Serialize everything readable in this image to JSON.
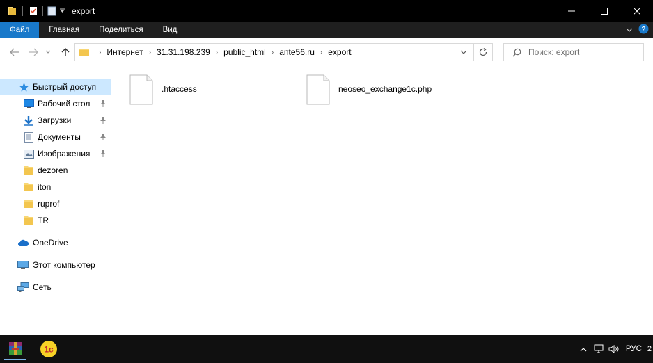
{
  "window": {
    "title": "export"
  },
  "ribbon": {
    "tabs": [
      "Файл",
      "Главная",
      "Поделиться",
      "Вид"
    ]
  },
  "address": {
    "breadcrumbs": [
      "Интернет",
      "31.31.198.239",
      "public_html",
      "ante56.ru",
      "export"
    ]
  },
  "search": {
    "placeholder": "Поиск: export"
  },
  "sidebar": {
    "quick_access": "Быстрый доступ",
    "items": [
      {
        "label": "Рабочий стол",
        "icon": "desktop-icon",
        "pinned": true
      },
      {
        "label": "Загрузки",
        "icon": "download-icon",
        "pinned": true
      },
      {
        "label": "Документы",
        "icon": "documents-icon",
        "pinned": true
      },
      {
        "label": "Изображения",
        "icon": "pictures-icon",
        "pinned": true
      },
      {
        "label": "dezoren",
        "icon": "folder-icon",
        "pinned": false
      },
      {
        "label": "iton",
        "icon": "folder-icon",
        "pinned": false
      },
      {
        "label": "ruprof",
        "icon": "folder-icon",
        "pinned": false
      },
      {
        "label": "TR",
        "icon": "folder-icon",
        "pinned": false
      }
    ],
    "onedrive": "OneDrive",
    "this_pc": "Этот компьютер",
    "network": "Сеть"
  },
  "files": [
    {
      "name": ".htaccess",
      "icon": "file-icon"
    },
    {
      "name": "neoseo_exchange1c.php",
      "icon": "file-icon"
    }
  ],
  "taskbar": {
    "apps": [
      "winrar-icon",
      "1c-icon"
    ],
    "language": "РУС",
    "clock_partial": "2"
  },
  "colors": {
    "accent": "#1979ca",
    "selected": "#cce8ff",
    "folder": "#f8d775"
  }
}
